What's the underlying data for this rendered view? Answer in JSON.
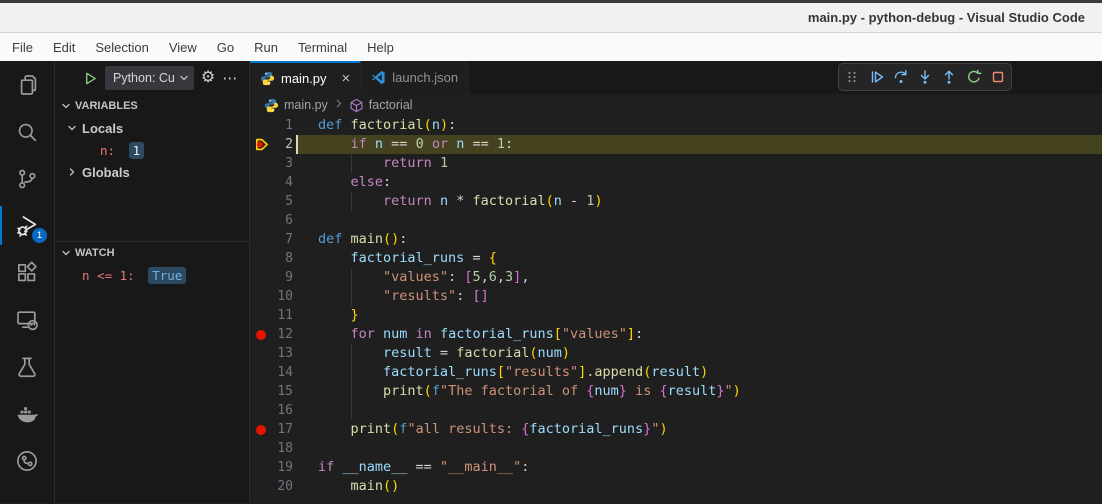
{
  "window": {
    "title": "main.py - python-debug - Visual Studio Code"
  },
  "menu": {
    "items": [
      "File",
      "Edit",
      "Selection",
      "View",
      "Go",
      "Run",
      "Terminal",
      "Help"
    ]
  },
  "activity_bar": {
    "items": [
      {
        "icon": "explorer-icon",
        "active": false
      },
      {
        "icon": "search-icon",
        "active": false
      },
      {
        "icon": "source-control-icon",
        "active": false
      },
      {
        "icon": "run-and-debug-icon",
        "active": true,
        "badge": "1"
      },
      {
        "icon": "extensions-icon",
        "active": false
      },
      {
        "icon": "remote-explorer-icon",
        "active": false
      },
      {
        "icon": "testing-icon",
        "active": false
      },
      {
        "icon": "docker-icon",
        "active": false
      },
      {
        "icon": "git-graph-icon",
        "active": false
      }
    ]
  },
  "debug_sidebar": {
    "config_label": "Python: Cu",
    "gear": "⚙",
    "more": "⋯",
    "variables": {
      "header": "VARIABLES",
      "locals_label": "Locals",
      "globals_label": "Globals",
      "locals": [
        {
          "name": "n: ",
          "value": "1"
        }
      ]
    },
    "watch": {
      "header": "WATCH",
      "items": [
        {
          "expr": "n <= 1: ",
          "value": "True"
        }
      ]
    }
  },
  "editor": {
    "tabs": [
      {
        "label": "main.py",
        "icon": "python-icon",
        "active": true,
        "close": "×"
      },
      {
        "label": "launch.json",
        "icon": "vscode-icon",
        "active": false
      }
    ],
    "breadcrumb": {
      "file": "main.py",
      "file_icon": "python-icon",
      "symbol": "factorial",
      "symbol_icon": "symbol-method-icon"
    },
    "debug_toolbar": [
      {
        "icon": "grip-icon"
      },
      {
        "icon": "continue-icon"
      },
      {
        "icon": "step-over-icon"
      },
      {
        "icon": "step-into-icon"
      },
      {
        "icon": "step-out-icon"
      },
      {
        "icon": "restart-icon"
      },
      {
        "icon": "stop-icon"
      }
    ],
    "code": {
      "language": "python",
      "lines": [
        {
          "num": "1",
          "tokens": [
            [
              "kw2",
              "def "
            ],
            [
              "fn",
              "factorial"
            ],
            [
              "b1",
              "("
            ],
            [
              "var",
              "n"
            ],
            [
              "b1",
              ")"
            ],
            [
              "op",
              ":"
            ]
          ]
        },
        {
          "num": "2",
          "current": true,
          "glyph": "current-breakpoint-icon",
          "tokens": [
            [
              "op",
              "    "
            ],
            [
              "kw1",
              "if "
            ],
            [
              "var",
              "n"
            ],
            [
              "op",
              " == "
            ],
            [
              "num",
              "0"
            ],
            [
              "kw1",
              " or "
            ],
            [
              "var",
              "n"
            ],
            [
              "op",
              " == "
            ],
            [
              "num",
              "1"
            ],
            [
              "op",
              ":"
            ]
          ]
        },
        {
          "num": "3",
          "guide": true,
          "tokens": [
            [
              "op",
              "        "
            ],
            [
              "kw1",
              "return "
            ],
            [
              "num",
              "1"
            ]
          ]
        },
        {
          "num": "4",
          "tokens": [
            [
              "op",
              "    "
            ],
            [
              "kw1",
              "else"
            ],
            [
              "op",
              ":"
            ]
          ]
        },
        {
          "num": "5",
          "guide": true,
          "tokens": [
            [
              "op",
              "        "
            ],
            [
              "kw1",
              "return "
            ],
            [
              "var",
              "n"
            ],
            [
              "op",
              " * "
            ],
            [
              "fn",
              "factorial"
            ],
            [
              "b1",
              "("
            ],
            [
              "var",
              "n"
            ],
            [
              "op",
              " - "
            ],
            [
              "num",
              "1"
            ],
            [
              "b1",
              ")"
            ]
          ]
        },
        {
          "num": "6",
          "tokens": []
        },
        {
          "num": "7",
          "tokens": [
            [
              "kw2",
              "def "
            ],
            [
              "fn",
              "main"
            ],
            [
              "b1",
              "()"
            ],
            [
              "op",
              ":"
            ]
          ]
        },
        {
          "num": "8",
          "tokens": [
            [
              "op",
              "    "
            ],
            [
              "var",
              "factorial_runs"
            ],
            [
              "op",
              " = "
            ],
            [
              "b1",
              "{"
            ]
          ]
        },
        {
          "num": "9",
          "guide": true,
          "tokens": [
            [
              "op",
              "        "
            ],
            [
              "str",
              "\"values\""
            ],
            [
              "op",
              ": "
            ],
            [
              "b2",
              "["
            ],
            [
              "num",
              "5"
            ],
            [
              "op",
              ","
            ],
            [
              "num",
              "6"
            ],
            [
              "op",
              ","
            ],
            [
              "num",
              "3"
            ],
            [
              "b2",
              "]"
            ],
            [
              "op",
              ","
            ]
          ]
        },
        {
          "num": "10",
          "guide": true,
          "tokens": [
            [
              "op",
              "        "
            ],
            [
              "str",
              "\"results\""
            ],
            [
              "op",
              ": "
            ],
            [
              "b2",
              "[]"
            ]
          ]
        },
        {
          "num": "11",
          "tokens": [
            [
              "op",
              "    "
            ],
            [
              "b1",
              "}"
            ]
          ]
        },
        {
          "num": "12",
          "breakpoint": true,
          "tokens": [
            [
              "op",
              "    "
            ],
            [
              "kw1",
              "for "
            ],
            [
              "var",
              "num"
            ],
            [
              "kw1",
              " in "
            ],
            [
              "var",
              "factorial_runs"
            ],
            [
              "b1",
              "["
            ],
            [
              "str",
              "\"values\""
            ],
            [
              "b1",
              "]"
            ],
            [
              "op",
              ":"
            ]
          ]
        },
        {
          "num": "13",
          "guide": true,
          "tokens": [
            [
              "op",
              "        "
            ],
            [
              "var",
              "result"
            ],
            [
              "op",
              " = "
            ],
            [
              "fn",
              "factorial"
            ],
            [
              "b1",
              "("
            ],
            [
              "var",
              "num"
            ],
            [
              "b1",
              ")"
            ]
          ]
        },
        {
          "num": "14",
          "guide": true,
          "tokens": [
            [
              "op",
              "        "
            ],
            [
              "var",
              "factorial_runs"
            ],
            [
              "b1",
              "["
            ],
            [
              "str",
              "\"results\""
            ],
            [
              "b1",
              "]"
            ],
            [
              "op",
              "."
            ],
            [
              "fn",
              "append"
            ],
            [
              "b1",
              "("
            ],
            [
              "var",
              "result"
            ],
            [
              "b1",
              ")"
            ]
          ]
        },
        {
          "num": "15",
          "guide": true,
          "tokens": [
            [
              "op",
              "        "
            ],
            [
              "fn",
              "print"
            ],
            [
              "b1",
              "("
            ],
            [
              "kw2",
              "f"
            ],
            [
              "str",
              "\"The factorial of "
            ],
            [
              "b2",
              "{"
            ],
            [
              "var",
              "num"
            ],
            [
              "b2",
              "}"
            ],
            [
              "str",
              " is "
            ],
            [
              "b2",
              "{"
            ],
            [
              "var",
              "result"
            ],
            [
              "b2",
              "}"
            ],
            [
              "str",
              "\""
            ],
            [
              "b1",
              ")"
            ]
          ]
        },
        {
          "num": "16",
          "guide": true,
          "tokens": []
        },
        {
          "num": "17",
          "breakpoint": true,
          "tokens": [
            [
              "op",
              "    "
            ],
            [
              "fn",
              "print"
            ],
            [
              "b1",
              "("
            ],
            [
              "kw2",
              "f"
            ],
            [
              "str",
              "\"all results: "
            ],
            [
              "b2",
              "{"
            ],
            [
              "var",
              "factorial_runs"
            ],
            [
              "b2",
              "}"
            ],
            [
              "str",
              "\""
            ],
            [
              "b1",
              ")"
            ]
          ]
        },
        {
          "num": "18",
          "tokens": []
        },
        {
          "num": "19",
          "tokens": [
            [
              "kw1",
              "if "
            ],
            [
              "var",
              "__name__"
            ],
            [
              "op",
              " == "
            ],
            [
              "str",
              "\"__main__\""
            ],
            [
              "op",
              ":"
            ]
          ]
        },
        {
          "num": "20",
          "tokens": [
            [
              "op",
              "    "
            ],
            [
              "fn",
              "main"
            ],
            [
              "b1",
              "()"
            ]
          ]
        }
      ]
    }
  },
  "colors": {
    "accent_blue": "#0078d4",
    "breakpoint_red": "#e51400",
    "current_line_bg": "#45431f",
    "debug_blue": "#75beff",
    "debug_green": "#89d185",
    "debug_red": "#f48771",
    "badge_blue": "#0868c4",
    "titlebar_bg": "#f2f1f0",
    "editor_bg": "#1f1f1f",
    "chrome_bg": "#181818"
  }
}
